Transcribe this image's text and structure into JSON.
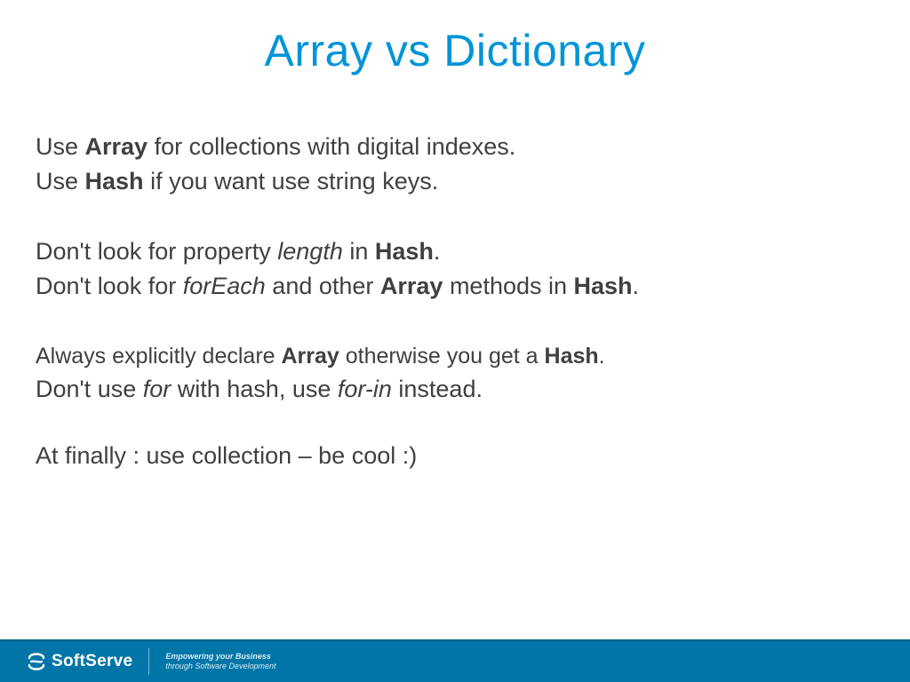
{
  "title": "Array vs Dictionary",
  "lines": {
    "l1": {
      "pre": "Use ",
      "b1": "Array",
      "post": " for collections with digital indexes."
    },
    "l2": {
      "pre": "Use ",
      "b1": "Hash",
      "post": " if you want use string keys."
    },
    "l3": {
      "pre": "Don't look for property ",
      "i1": "length",
      "mid": " in ",
      "b1": "Hash",
      "post": "."
    },
    "l4": {
      "pre": "Don't look for ",
      "i1": "forEach",
      "mid": " and other ",
      "b1": "Array",
      "mid2": " methods in ",
      "b2": "Hash",
      "post": "."
    },
    "l5": {
      "pre": "Always explicitly declare ",
      "b1": "Array",
      "mid": " otherwise you get a ",
      "b2": "Hash",
      "post": "."
    },
    "l6": {
      "pre": "Don't use ",
      "i1": "for",
      "mid": " with hash, use ",
      "i2": "for-in",
      "post": " instead."
    },
    "l7": {
      "text": "At finally : use collection – be cool :)"
    }
  },
  "footer": {
    "brand": "SoftServe",
    "tagline1": "Empowering your Business",
    "tagline2": "through Software Development"
  }
}
